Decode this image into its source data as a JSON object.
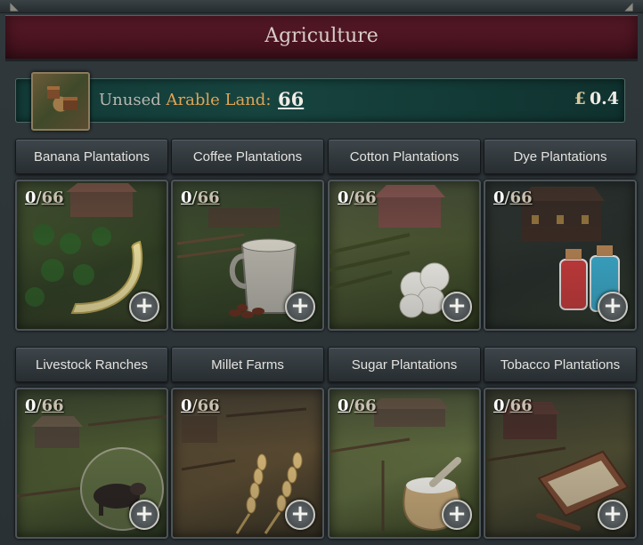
{
  "window": {
    "title": "Agriculture"
  },
  "land": {
    "label_prefix": "Unused",
    "label_highlight": "Arable Land",
    "label_colon": ":",
    "value": "66",
    "currency": "£",
    "income": "0.4"
  },
  "cards": [
    {
      "name": "Banana Plantations",
      "built": "0",
      "max": "66"
    },
    {
      "name": "Coffee Plantations",
      "built": "0",
      "max": "66"
    },
    {
      "name": "Cotton Plantations",
      "built": "0",
      "max": "66"
    },
    {
      "name": "Dye Plantations",
      "built": "0",
      "max": "66"
    },
    {
      "name": "Livestock Ranches",
      "built": "0",
      "max": "66"
    },
    {
      "name": "Millet Farms",
      "built": "0",
      "max": "66"
    },
    {
      "name": "Sugar Plantations",
      "built": "0",
      "max": "66"
    },
    {
      "name": "Tobacco Plantations",
      "built": "0",
      "max": "66"
    }
  ],
  "add_symbol": "+",
  "colors": {
    "header": "#4a1421",
    "land_bar": "#17443f",
    "highlight": "#e0a455"
  }
}
